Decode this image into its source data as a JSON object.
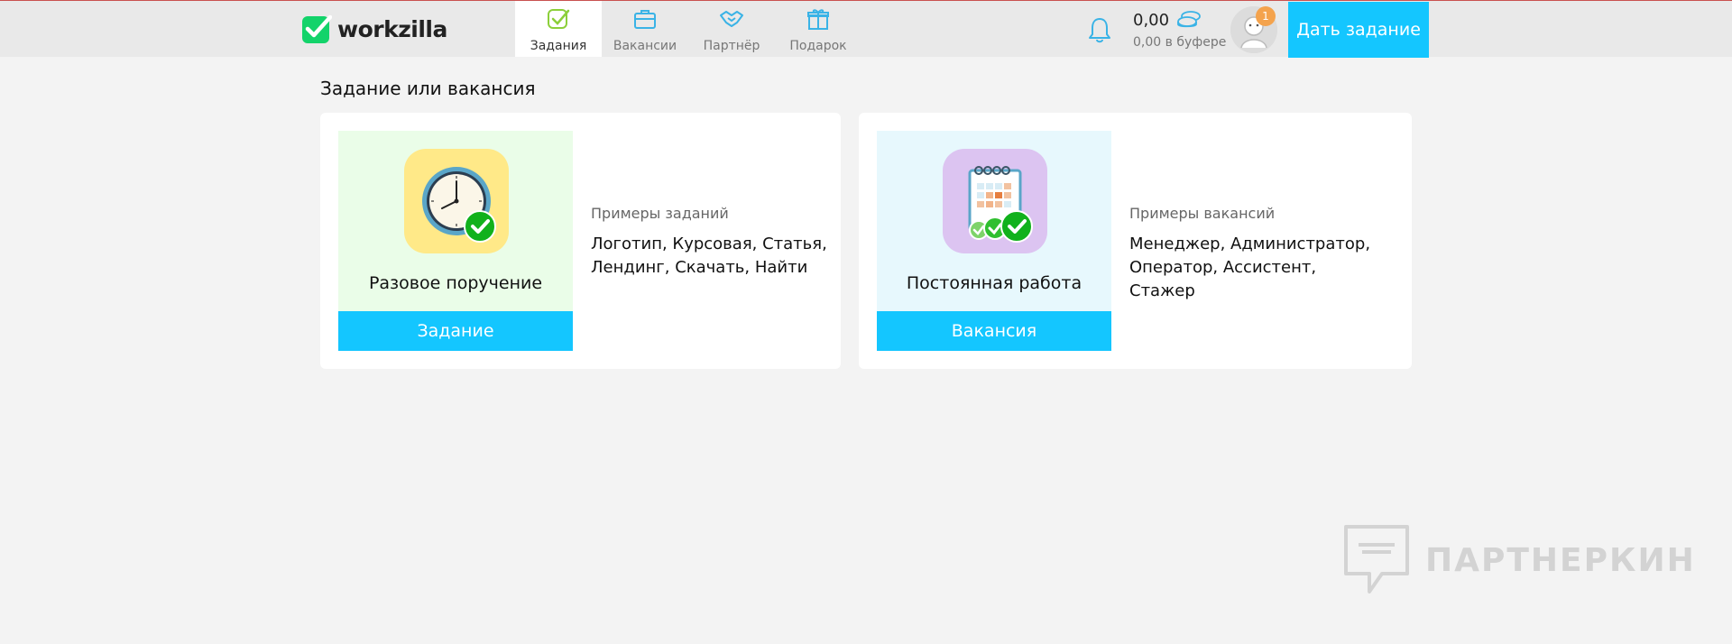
{
  "header": {
    "logo_text": "workzilla",
    "nav": [
      {
        "label": "Задания",
        "icon": "task-check-icon",
        "active": true
      },
      {
        "label": "Вакансии",
        "icon": "briefcase-icon",
        "active": false
      },
      {
        "label": "Партнёр",
        "icon": "handshake-icon",
        "active": false
      },
      {
        "label": "Подарок",
        "icon": "gift-icon",
        "active": false
      }
    ],
    "balance": {
      "amount": "0,00",
      "buffer": "0,00 в буфере"
    },
    "notifications_badge": "1",
    "cta_label": "Дать задание"
  },
  "main": {
    "title": "Задание или вакансия",
    "cards": [
      {
        "tile_title": "Разовое поручение",
        "button_label": "Задание",
        "examples_label": "Примеры заданий",
        "examples_text": "Логотип, Курсовая, Статья, Лендинг, Скачать, Найти"
      },
      {
        "tile_title": "Постоянная работа",
        "button_label": "Вакансия",
        "examples_label": "Примеры вакансий",
        "examples_text": "Менеджер, Администратор, Оператор, Ассистент, Стажер"
      }
    ]
  },
  "watermark": {
    "text": "ПАРТНЕРКИН"
  },
  "colors": {
    "accent": "#14c6ff",
    "green_tile": "#eafde8",
    "cyan_tile": "#e7f8fd",
    "badge": "#f4a34d"
  }
}
